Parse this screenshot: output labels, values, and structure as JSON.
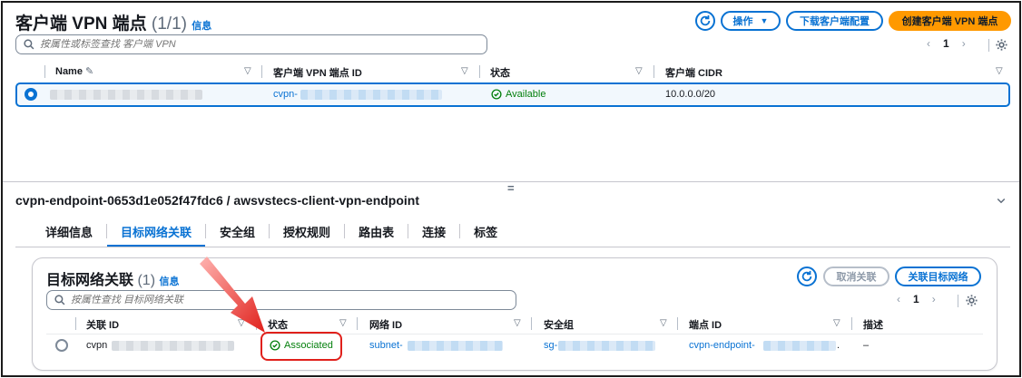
{
  "top": {
    "title": "客户端 VPN 端点",
    "count": "(1/1)",
    "info": "信息",
    "actions_label": "操作",
    "download_label": "下载客户端配置",
    "create_label": "创建客户端 VPN 端点",
    "search_placeholder": "按属性或标签查找 客户端 VPN",
    "page": "1",
    "columns": [
      "Name",
      "客户端 VPN 端点 ID",
      "状态",
      "客户端 CIDR"
    ],
    "row": {
      "endpoint_prefix": "cvpn-",
      "status": "Available",
      "cidr": "10.0.0.0/20"
    }
  },
  "divider_glyph": "=",
  "detail": {
    "heading": "cvpn-endpoint-0653d1e052f47fdc6 / awsvstecs-client-vpn-endpoint",
    "tabs": [
      "详细信息",
      "目标网络关联",
      "安全组",
      "授权规则",
      "路由表",
      "连接",
      "标签"
    ],
    "active_tab": 1
  },
  "assoc": {
    "title": "目标网络关联",
    "count": "(1)",
    "info": "信息",
    "disassociate_label": "取消关联",
    "associate_label": "关联目标网络",
    "search_placeholder": "按属性查找 目标网络关联",
    "page": "1",
    "columns": [
      "关联 ID",
      "状态",
      "网络 ID",
      "安全组",
      "端点 ID",
      "描述"
    ],
    "row": {
      "id_prefix": "cvpn",
      "status": "Associated",
      "network_prefix": "subnet-",
      "sg_prefix": "sg-",
      "endpoint_prefix": "cvpn-endpoint-",
      "endpoint_suffix": ".",
      "description": "–"
    }
  },
  "colors": {
    "accent": "#0972d3",
    "primary": "#ff9900",
    "success": "#037f0c",
    "highlight": "#e0201b"
  }
}
